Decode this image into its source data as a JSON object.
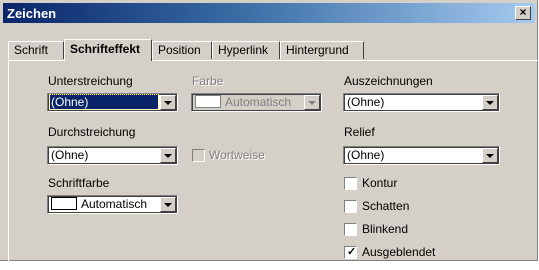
{
  "window": {
    "title": "Zeichen",
    "close_label": "×"
  },
  "tabs": [
    {
      "label": "Schrift",
      "active": false
    },
    {
      "label": "Schrifteffekt",
      "active": true
    },
    {
      "label": "Position",
      "active": false
    },
    {
      "label": "Hyperlink",
      "active": false
    },
    {
      "label": "Hintergrund",
      "active": false
    }
  ],
  "form": {
    "underline": {
      "label": "Unterstreichung",
      "value": "(Ohne)"
    },
    "color": {
      "label": "Farbe",
      "value": "Automatisch",
      "enabled": false
    },
    "strikethrough": {
      "label": "Durchstreichung",
      "value": "(Ohne)"
    },
    "word_by_word": {
      "label": "Wortweise",
      "checked": false,
      "enabled": false
    },
    "font_color": {
      "label": "Schriftfarbe",
      "value": "Automatisch"
    },
    "emphasis": {
      "label": "Auszeichnungen",
      "value": "(Ohne)"
    },
    "relief": {
      "label": "Relief",
      "value": "(Ohne)"
    },
    "contour": {
      "label": "Kontur",
      "checked": false
    },
    "shadow": {
      "label": "Schatten",
      "checked": false
    },
    "blinking": {
      "label": "Blinkend",
      "checked": false
    },
    "hidden": {
      "label": "Ausgeblendet",
      "checked": true
    }
  },
  "colors": {
    "titlebar_start": "#0a246a",
    "titlebar_end": "#a6caf0",
    "dialog_bg": "#d4d0c8",
    "selection": "#0a246a"
  }
}
